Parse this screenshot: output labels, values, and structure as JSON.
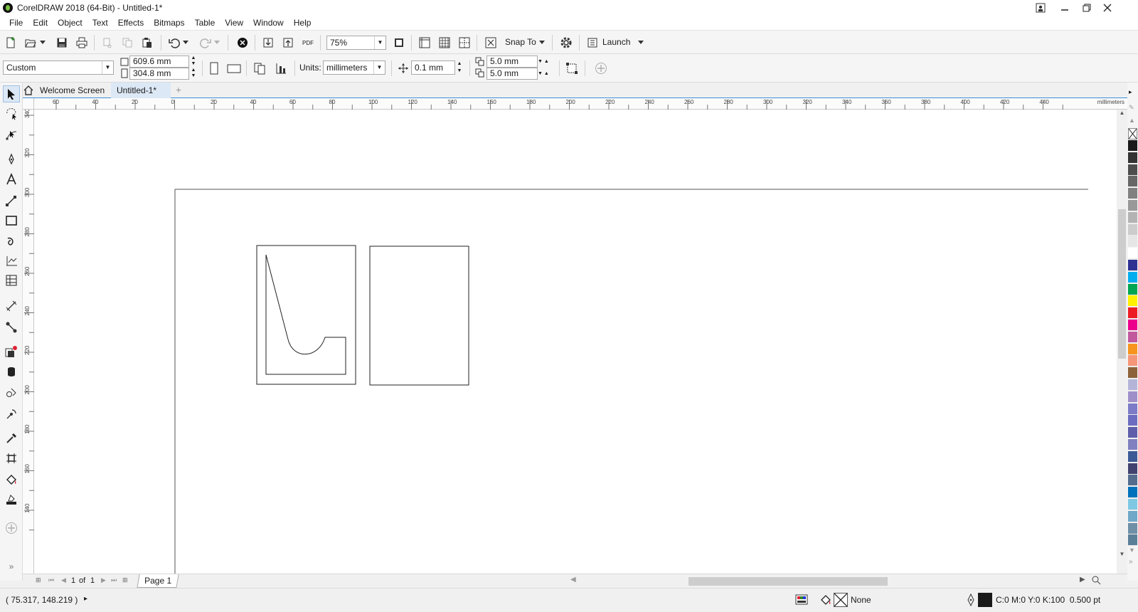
{
  "window": {
    "title": "CorelDRAW 2018 (64-Bit) - Untitled-1*",
    "controls": [
      "minimize",
      "restore",
      "close"
    ]
  },
  "menu": [
    "File",
    "Edit",
    "Object",
    "Text",
    "Effects",
    "Bitmaps",
    "Table",
    "View",
    "Window",
    "Help"
  ],
  "standard_toolbar": {
    "zoom": "75%",
    "pdf_label": "PDF",
    "snap_to_label": "Snap To",
    "launch_label": "Launch"
  },
  "property_bar": {
    "page_preset": "Custom",
    "width": "609.6 mm",
    "height": "304.8 mm",
    "units_label": "Units:",
    "units": "millimeters",
    "nudge": "0.1 mm",
    "dup_x": "5.0 mm",
    "dup_y": "5.0 mm"
  },
  "tabs": [
    {
      "label": "Welcome Screen",
      "active": false
    },
    {
      "label": "Untitled-1*",
      "active": true
    }
  ],
  "ruler": {
    "unit": "millimeters",
    "h_labels": [
      "60",
      "40",
      "20",
      "0",
      "20",
      "40",
      "60",
      "80",
      "100",
      "120",
      "140",
      "160",
      "180",
      "200",
      "220",
      "240",
      "260",
      "280",
      "300",
      "320",
      "340",
      "360",
      "380",
      "400",
      "420",
      "440"
    ],
    "v_labels": [
      "340",
      "320",
      "300",
      "280",
      "260",
      "240",
      "220",
      "200",
      "180",
      "160",
      "140"
    ]
  },
  "page_nav": {
    "current": "1",
    "of_label": "of",
    "total": "1",
    "page_tab": "Page 1"
  },
  "status": {
    "cursor": "( 75.317, 148.219 )",
    "fill": "None",
    "outline": "C:0 M:0 Y:0 K:100  0.500 pt"
  },
  "palette_colors": [
    "#1a1a1a",
    "#333333",
    "#4d4d4d",
    "#666666",
    "#808080",
    "#999999",
    "#b3b3b3",
    "#cccccc",
    "#e6e6e6",
    "#ffffff",
    "#2e3192",
    "#00aeef",
    "#00a651",
    "#fff200",
    "#ed1c24",
    "#ec008c",
    "#c2589d",
    "#f7941d",
    "#f69679",
    "#8c6239",
    "#b4b4d8",
    "#9f8fc9",
    "#7b7bc7",
    "#6c6cc0",
    "#5e5eaa",
    "#8080c0",
    "#3c5a96",
    "#424270",
    "#536c8e",
    "#0072bc",
    "#7ec8e3",
    "#6fa8c8",
    "#6e8fa6",
    "#5c7f98"
  ]
}
